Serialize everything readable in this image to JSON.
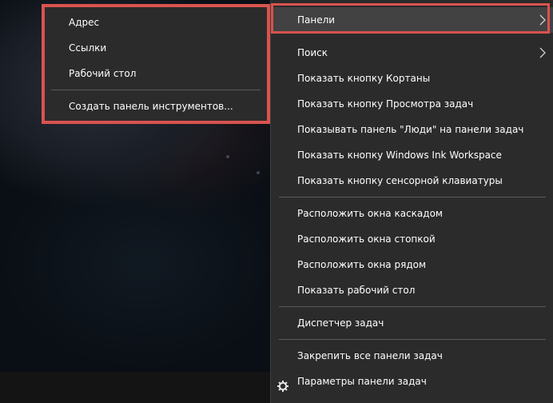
{
  "submenu": {
    "items": [
      {
        "label": "Адрес"
      },
      {
        "label": "Ссылки"
      },
      {
        "label": "Рабочий стол"
      },
      {
        "label": "Создать панель инструментов..."
      }
    ]
  },
  "menu": {
    "items": [
      {
        "label": "Панели"
      },
      {
        "label": "Поиск"
      },
      {
        "label": "Показать кнопку Кортаны"
      },
      {
        "label": "Показать кнопку Просмотра задач"
      },
      {
        "label": "Показывать панель \"Люди\" на панели задач"
      },
      {
        "label": "Показать кнопку Windows Ink Workspace"
      },
      {
        "label": "Показать кнопку сенсорной клавиатуры"
      },
      {
        "label": "Расположить окна каскадом"
      },
      {
        "label": "Расположить окна стопкой"
      },
      {
        "label": "Расположить окна рядом"
      },
      {
        "label": "Показать рабочий стол"
      },
      {
        "label": "Диспетчер задач"
      },
      {
        "label": "Закрепить все панели задач"
      },
      {
        "label": "Параметры панели задач"
      }
    ]
  },
  "colors": {
    "menu_bg": "#2b2b2b",
    "hover_bg": "#424242",
    "annotation_red": "#d9534f",
    "text": "#ffffff"
  },
  "icons": {
    "submenu_arrow": "chevron-right-icon",
    "settings": "gear-icon"
  }
}
